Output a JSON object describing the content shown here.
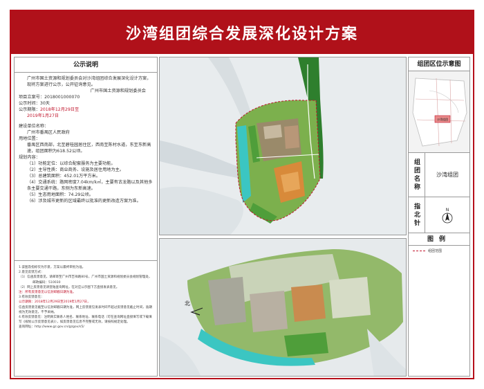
{
  "title": "沙湾组团综合发展深化设计方案",
  "notice": {
    "heading": "公示说明",
    "intro": "广州市国土资源和规划委员会对沙湾组团综合发展深化设计方案，现将方案进行公示，公开征询意见。",
    "issuer": "广州市国土资源和规划委员会",
    "project_no": "项目立案号：2018001000070",
    "duration": "公示时间：30天",
    "period_label": "公示期限：",
    "period_start": "2018年12月29日至",
    "period_end": "2019年1月27日",
    "builder_label": "建设单位名称：",
    "builder": "广州市番禺区人民政府",
    "location_label": "用地位置：",
    "location": "番禺区西南部，北至碧桂园居住区，西南至陈村水道，东至东新高速，组团面积为618.52公顷。",
    "planning_label": "规划内容：",
    "items": [
      "（1）功能定位：以综合配套服务为主要功能。",
      "（2）主导性质：商业商务、设施及居住用地为主。",
      "（3）总建筑面积：452.01万平方米。",
      "（4）交通系统：路网密度7.04km/k㎡，主要有古龙路以及其他多条主要交通干路，东侧为东新高速。",
      "（5）生态用地面积：74.29公顷。",
      "（6）涉及城市更新的区域最终以批准的更新改造方案为准。"
    ]
  },
  "notes": [
    "1.该图及指标仅为示意，方案以最终审批为准。",
    "2.意见反馈方式：",
    "（1）信函反馈意见，请邮寄至广州市吉祥路80号，广州市国土资源和规划委员会规划管理处，",
    "邮政编码：510030",
    "（2）网上反馈意见请登陆查询网址，在对应公示图下方直接发表意见。",
    "注：所有反馈意见以信封邮戳日期为准。",
    "3.有效反馈意见：",
    "公示期限：2018年12月29日至2019年1月27日，",
    "信函反馈意见截至以信封邮戳日期为准，网上反馈意见发表时间不超过反馈意见截止时间，逾期视为无效意见，不予采纳。",
    "4.有效反馈意见：注明真实联系人姓名、联系地址、联系电话（可在查询网址直接填写或下载填写《规划公示反馈意见表》），如反馈意见信息不完整或无效，请按照规定处理。",
    "查询网址：http://www.gz.gov.cn/gzgov/s5/"
  ],
  "location_map": {
    "heading": "组团区位示意图",
    "highlight_label": "沙湾组团"
  },
  "group_name": {
    "label": "组团名称",
    "value": "沙湾组团"
  },
  "north": {
    "label": "指北针",
    "letter": "N"
  },
  "legend": {
    "heading": "图例",
    "boundary_label": "组团范围"
  },
  "aerial": {
    "north_label": "北"
  },
  "colors": {
    "banner": "#b0111a",
    "boundary": "#c0142b",
    "water": "#3bc6c2",
    "green": "#4f9e3a"
  }
}
